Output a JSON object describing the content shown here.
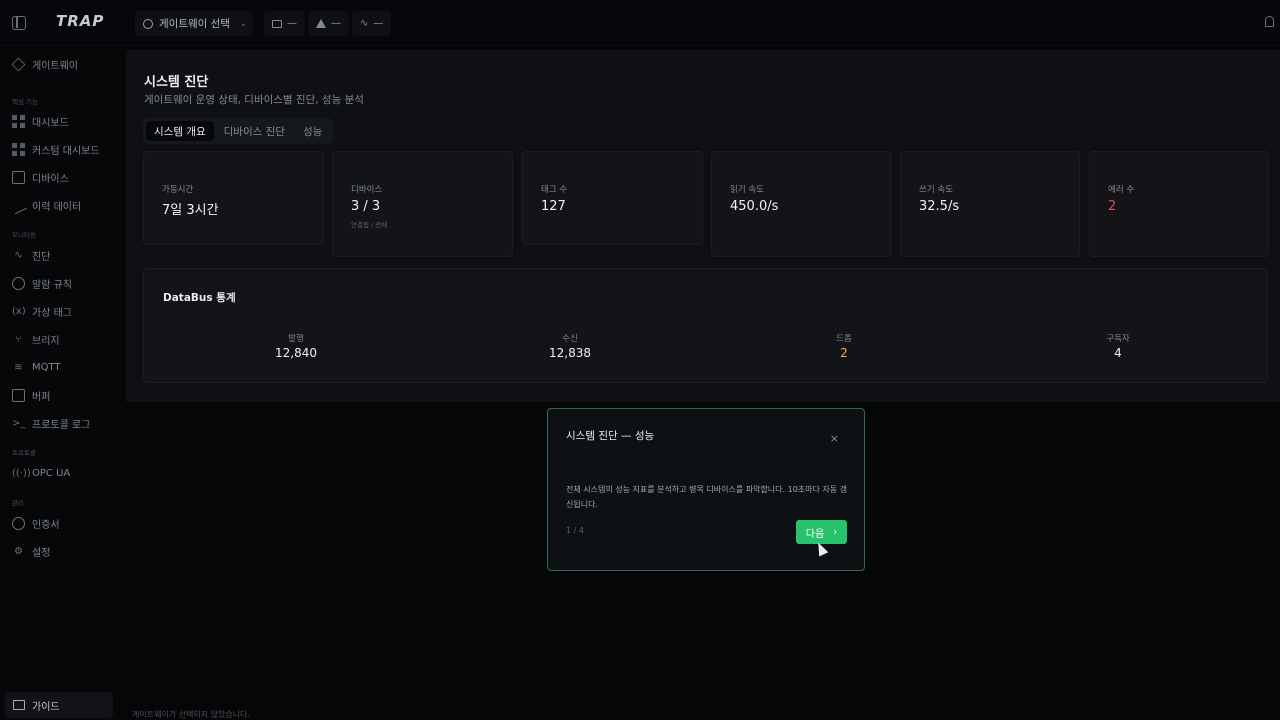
{
  "app": {
    "logo": "TRAP"
  },
  "header": {
    "gateway_select": "게이트웨이 선택",
    "status_dash": "—",
    "alerts_dash": "—",
    "activity_dash": "—"
  },
  "sidebar": {
    "top_item": "게이트웨이",
    "section_core": "핵심 기능",
    "core_items": [
      "대시보드",
      "커스텀 대시보드",
      "디바이스",
      "이력 데이터"
    ],
    "section_monitor": "모니터링",
    "monitor_items": [
      "진단",
      "알람 규칙",
      "가상 태그",
      "브리지",
      "MQTT",
      "버퍼",
      "프로토콜 로그"
    ],
    "section_protocol": "프로토콜",
    "protocol_items": [
      "OPC UA"
    ],
    "section_admin": "관리",
    "admin_items": [
      "인증서",
      "설정"
    ],
    "guide": "가이드"
  },
  "page": {
    "title": "시스템 진단",
    "subtitle": "게이트웨이 운영 상태, 디바이스별 진단, 성능 분석",
    "tabs": [
      "시스템 개요",
      "디바이스 진단",
      "성능"
    ]
  },
  "cards": [
    {
      "label": "가동시간",
      "value": "7일 3시간"
    },
    {
      "label": "디바이스",
      "value": "3 / 3",
      "note": "연결됨 / 전체"
    },
    {
      "label": "태그 수",
      "value": "127"
    },
    {
      "label": "읽기 속도",
      "value": "450.0/s"
    },
    {
      "label": "쓰기 속도",
      "value": "32.5/s"
    },
    {
      "label": "에러 수",
      "value": "2"
    }
  ],
  "databus": {
    "title": "DataBus 통계",
    "stats": [
      {
        "label": "발행",
        "value": "12,840"
      },
      {
        "label": "수신",
        "value": "12,838"
      },
      {
        "label": "드롭",
        "value": "2"
      },
      {
        "label": "구독자",
        "value": "4"
      }
    ]
  },
  "footer": {
    "status": "게이트웨이가 선택되지 않았습니다."
  },
  "modal": {
    "title": "시스템 진단 — 성능",
    "close": "×",
    "body": "전체 시스템의 성능 지표를 분석하고 병목 디바이스를 파악합니다. 10초마다 자동 갱신됩니다.",
    "step": "1 / 4",
    "next_label": "다음",
    "next_icon": "›"
  }
}
